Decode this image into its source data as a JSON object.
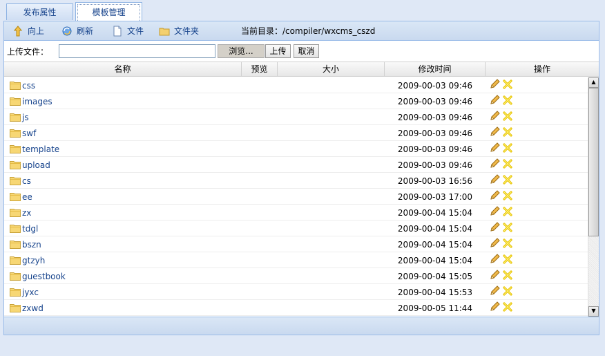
{
  "tabs": [
    {
      "label": "发布属性"
    },
    {
      "label": "模板管理"
    }
  ],
  "toolbar": {
    "up_label": "向上",
    "refresh_label": "刷新",
    "file_label": "文件",
    "folder_label": "文件夹",
    "current_dir_label": "当前目录：",
    "current_dir": "/compiler/wxcms_cszd"
  },
  "upload": {
    "label": "上传文件：",
    "value": "",
    "browse_label": "浏览...",
    "upload_label": "上传",
    "cancel_label": "取消"
  },
  "grid": {
    "columns": [
      "名称",
      "预览",
      "大小",
      "修改时间",
      "操作"
    ],
    "rows": [
      {
        "name": "css",
        "time": "2009-00-03 09:46"
      },
      {
        "name": "images",
        "time": "2009-00-03 09:46"
      },
      {
        "name": "js",
        "time": "2009-00-03 09:46"
      },
      {
        "name": "swf",
        "time": "2009-00-03 09:46"
      },
      {
        "name": "template",
        "time": "2009-00-03 09:46"
      },
      {
        "name": "upload",
        "time": "2009-00-03 09:46"
      },
      {
        "name": "cs",
        "time": "2009-00-03 16:56"
      },
      {
        "name": "ee",
        "time": "2009-00-03 17:00"
      },
      {
        "name": "zx",
        "time": "2009-00-04 15:04"
      },
      {
        "name": "tdgl",
        "time": "2009-00-04 15:04"
      },
      {
        "name": "bszn",
        "time": "2009-00-04 15:04"
      },
      {
        "name": "gtzyh",
        "time": "2009-00-04 15:04"
      },
      {
        "name": "guestbook",
        "time": "2009-00-04 15:05"
      },
      {
        "name": "jyxc",
        "time": "2009-00-04 15:53"
      },
      {
        "name": "zxwd",
        "time": "2009-00-05 11:44"
      }
    ]
  },
  "icons": {
    "row_folder": "folder-icon",
    "row_edit": "pencil-icon",
    "row_delete": "delete-x-icon"
  },
  "colors": {
    "accent": "#15428b",
    "border": "#99bbe8",
    "toolbar_bg": "#c9d9ef",
    "folder": "#f4c84a",
    "delete": "#e8c000"
  }
}
